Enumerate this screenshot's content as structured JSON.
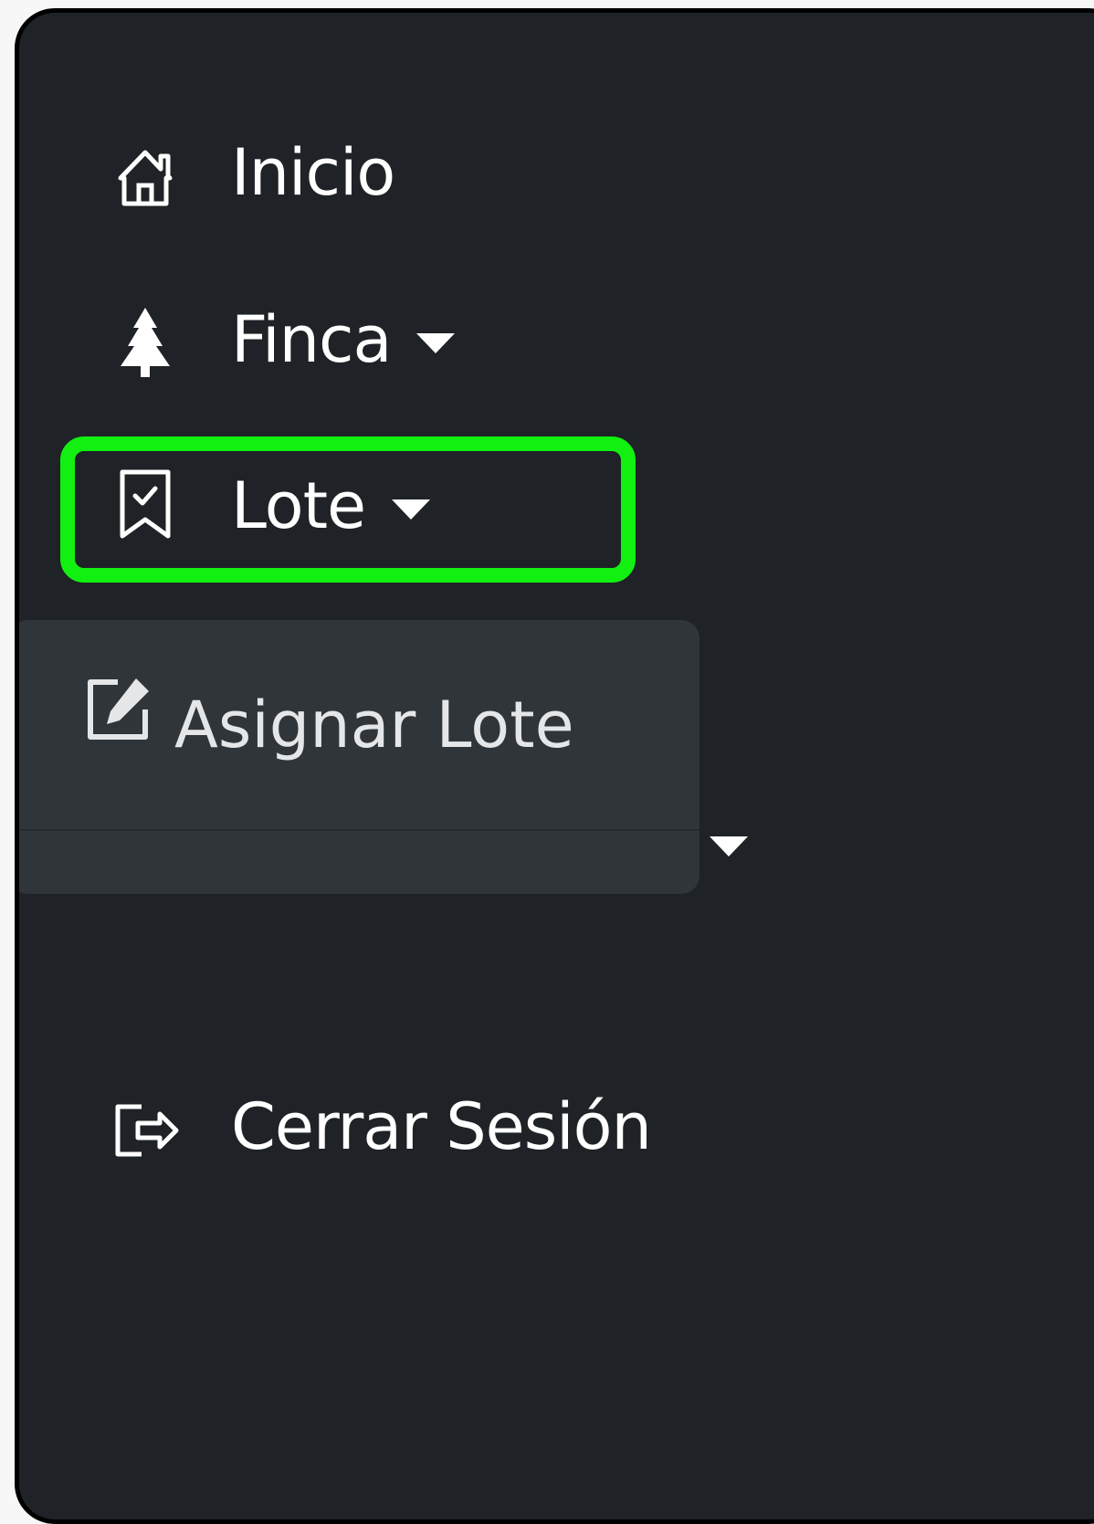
{
  "sidebar": {
    "items": [
      {
        "label": "Inicio",
        "icon": "house-icon"
      },
      {
        "label": "Finca",
        "icon": "tree-icon",
        "has_dropdown": true
      },
      {
        "label": "Lote",
        "icon": "bookmark-check-icon",
        "has_dropdown": true,
        "expanded": true
      },
      {
        "label": "",
        "icon": "",
        "has_dropdown": true
      },
      {
        "label": "Cerrar Sesión",
        "icon": "logout-icon"
      }
    ],
    "dropdown": {
      "items": [
        {
          "label": "Asignar Lote",
          "icon": "edit-icon"
        }
      ]
    }
  },
  "colors": {
    "background": "#1f2226",
    "text": "#ffffff",
    "dropdown_bg": "#30353a",
    "highlight": "#12f012"
  }
}
